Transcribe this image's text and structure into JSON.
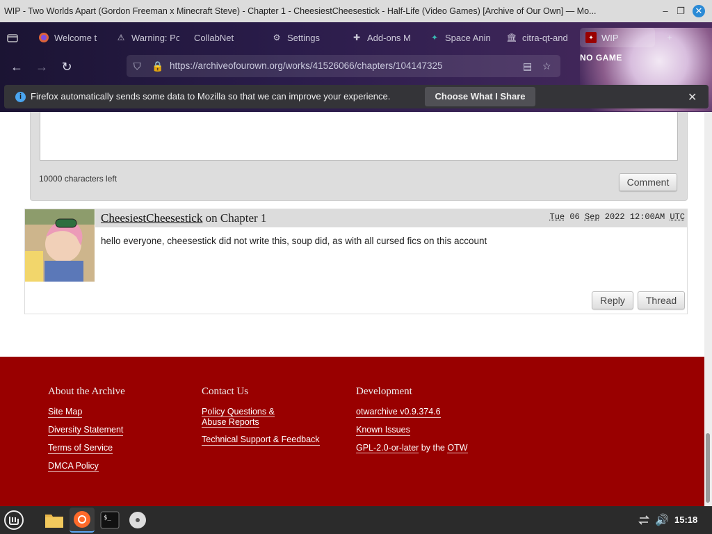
{
  "window": {
    "title": "WIP - Two Worlds Apart (Gordon Freeman x Minecraft Steve) - Chapter 1 - CheesiestCheesestick - Half-Life (Video Games) [Archive of Our Own] — Mo..."
  },
  "tabs": [
    {
      "label": "Welcome t",
      "icon": "firefox-icon"
    },
    {
      "label": "Warning: Po",
      "icon": "warning-icon"
    },
    {
      "label": "CollabNet",
      "icon": "none"
    },
    {
      "label": "Settings",
      "icon": "gear-icon"
    },
    {
      "label": "Add-ons M",
      "icon": "puzzle-icon"
    },
    {
      "label": "Space Anin",
      "icon": "space-icon"
    },
    {
      "label": "citra-qt-and",
      "icon": "bank-icon"
    },
    {
      "label": "WIP",
      "icon": "ao3-icon",
      "active": true
    }
  ],
  "nav": {
    "url": "https://archiveofourown.org/works/41526066/chapters/104147325"
  },
  "theme_art_text": "NO GAME",
  "notification": {
    "message": "Firefox automatically sends some data to Mozilla so that we can improve your experience.",
    "button": "Choose What I Share"
  },
  "comment_form": {
    "chars_left": "10000 characters left",
    "submit": "Comment"
  },
  "comment": {
    "author": "CheesiestCheesestick",
    "on_text": "on",
    "chapter": "Chapter 1",
    "date_parts": [
      "Tue",
      "06",
      "Sep",
      "2022",
      "12:00AM",
      "UTC"
    ],
    "body": "hello everyone, cheesestick did not write this, soup did, as with all cursed fics on this account",
    "actions": [
      "Reply",
      "Thread"
    ]
  },
  "footer": {
    "columns": [
      {
        "title": "About the Archive",
        "links": [
          "Site Map",
          "Diversity Statement",
          "Terms of Service",
          "DMCA Policy"
        ]
      },
      {
        "title": "Contact Us",
        "links": [
          "Policy Questions & Abuse Reports",
          "Technical Support & Feedback"
        ]
      },
      {
        "title": "Development",
        "links": [
          "otwarchive v0.9.374.6",
          "Known Issues",
          "GPL-2.0-or-later",
          "by the",
          "OTW"
        ]
      }
    ]
  },
  "taskbar": {
    "clock": "15:18"
  },
  "colors": {
    "footer_bg": "#990000",
    "notif_bg": "#343438",
    "info_blue": "#4aa5f0"
  }
}
